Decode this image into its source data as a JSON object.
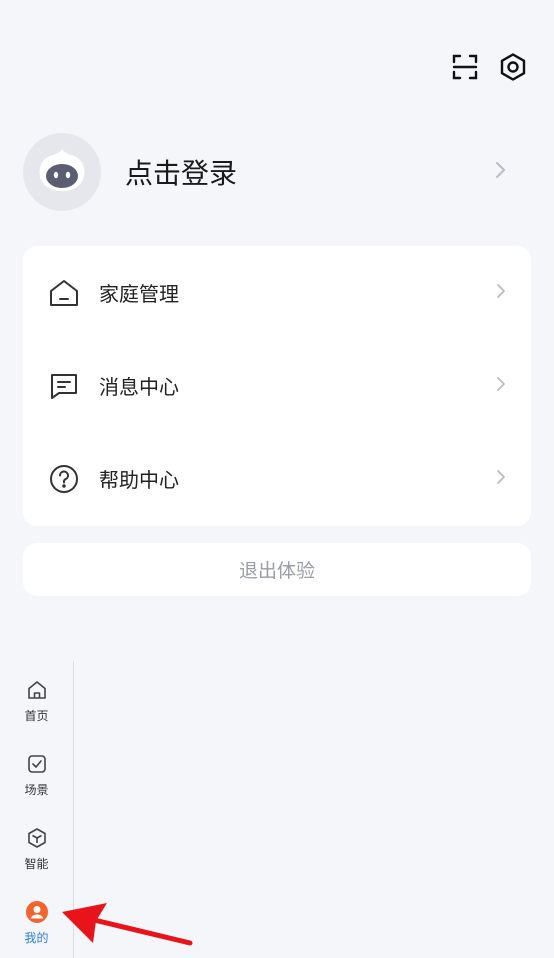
{
  "header": {
    "scan_icon": "scan-icon",
    "settings_icon": "hexagon-settings-icon"
  },
  "profile": {
    "login_label": "点击登录",
    "avatar_icon": "robot-avatar-icon"
  },
  "menu": [
    {
      "label": "家庭管理",
      "icon": "home-icon"
    },
    {
      "label": "消息中心",
      "icon": "message-icon"
    },
    {
      "label": "帮助中心",
      "icon": "help-icon"
    }
  ],
  "logout_label": "退出体验",
  "tabs": [
    {
      "label": "首页",
      "icon": "home-icon"
    },
    {
      "label": "场景",
      "icon": "checkbox-icon"
    },
    {
      "label": "智能",
      "icon": "cube-icon"
    },
    {
      "label": "我的",
      "icon": "user-icon",
      "active": true
    }
  ],
  "colors": {
    "accent": "#2f7de1",
    "active_icon": "#f2642c",
    "annotation_arrow": "#e8141c"
  }
}
